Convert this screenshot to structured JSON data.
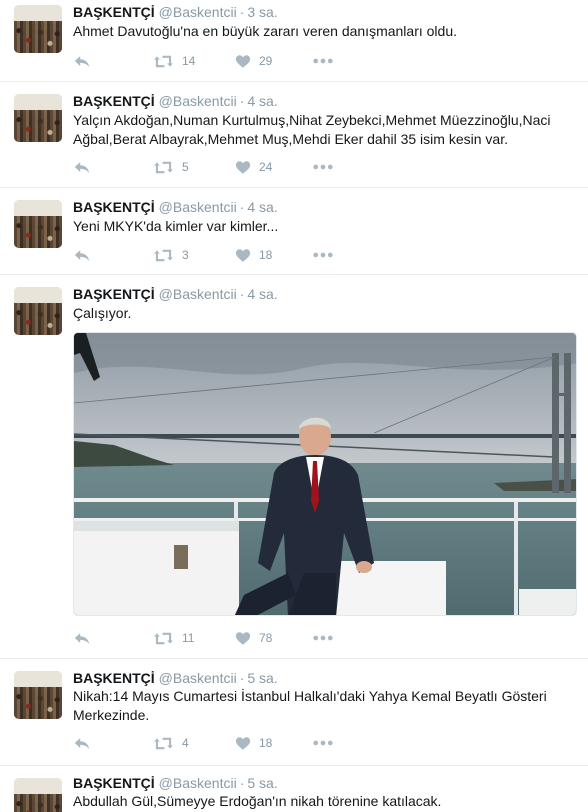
{
  "tweets": [
    {
      "name": "BAŞKENTÇİ",
      "handle": "@Baskentcii",
      "sep": "·",
      "time": "3 sa.",
      "text": "Ahmet Davutoğlu'na en büyük zararı veren danışmanları oldu.",
      "retweets": "14",
      "likes": "29"
    },
    {
      "name": "BAŞKENTÇİ",
      "handle": "@Baskentcii",
      "sep": "·",
      "time": "4 sa.",
      "text": "Yalçın Akdoğan,Numan Kurtulmuş,Nihat Zeybekci,Mehmet Müezzinoğlu,Naci Ağbal,Berat Albayrak,Mehmet Muş,Mehdi Eker dahil 35 isim kesin var.",
      "retweets": "5",
      "likes": "24"
    },
    {
      "name": "BAŞKENTÇİ",
      "handle": "@Baskentcii",
      "sep": "·",
      "time": "4 sa.",
      "text": "Yeni MKYK'da kimler var kimler...",
      "retweets": "3",
      "likes": "18"
    },
    {
      "name": "BAŞKENTÇİ",
      "handle": "@Baskentcii",
      "sep": "·",
      "time": "4 sa.",
      "text": "Çalışıyor.",
      "retweets": "11",
      "likes": "78"
    },
    {
      "name": "BAŞKENTÇİ",
      "handle": "@Baskentcii",
      "sep": "·",
      "time": "5 sa.",
      "text": "Nikah:14 Mayıs Cumartesi İstanbul Halkalı'daki Yahya Kemal Beyatlı Gösteri Merkezinde.",
      "retweets": "4",
      "likes": "18"
    },
    {
      "name": "BAŞKENTÇİ",
      "handle": "@Baskentcii",
      "sep": "·",
      "time": "5 sa.",
      "text": "Abdullah Gül,Sümeyye Erdoğan'ın nikah törenine katılacak."
    }
  ],
  "icons": {
    "reply": "reply-icon",
    "retweet": "retweet-icon",
    "like": "heart-icon",
    "more": "more-icon"
  },
  "colors": {
    "icon": "#aab8c2",
    "muted": "#8899a6",
    "divider": "#e6ecf0"
  }
}
